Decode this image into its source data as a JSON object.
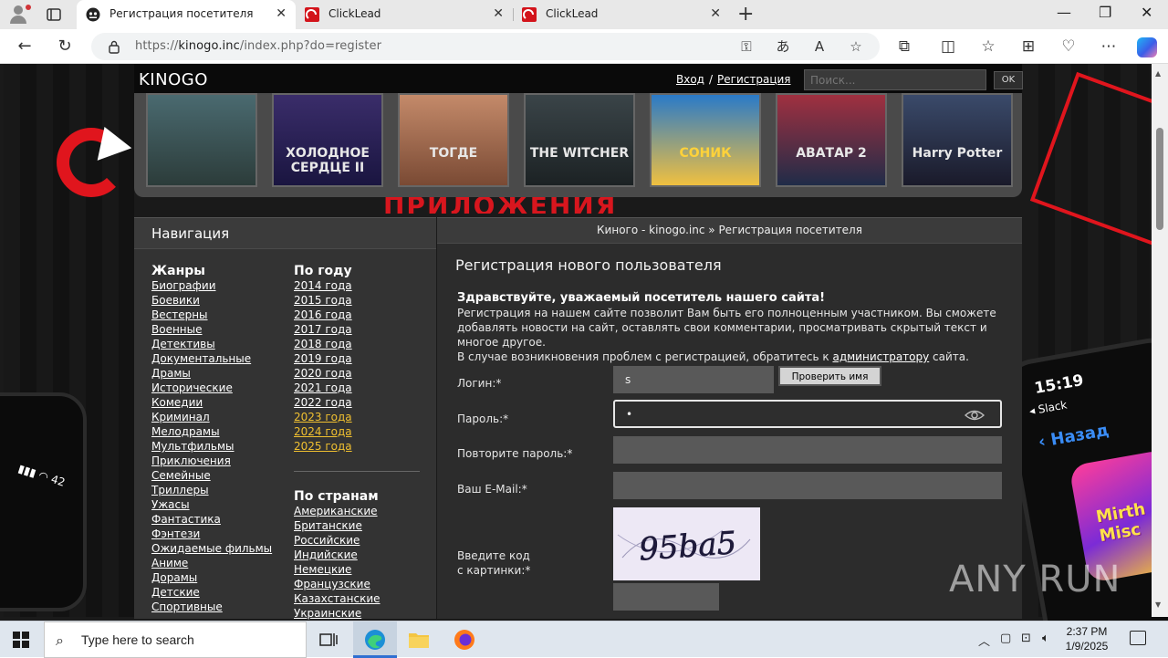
{
  "browser": {
    "tabs": [
      {
        "title": "Регистрация посетителя",
        "active": true
      },
      {
        "title": "ClickLead",
        "active": false
      },
      {
        "title": "ClickLead",
        "active": false
      }
    ],
    "url_prefix": "https://",
    "url_host": "kinogo.inc",
    "url_path": "/index.php?do=register"
  },
  "site": {
    "logo": "KINOGO",
    "login_link": "Вход",
    "link_separator": "/",
    "register_link": "Регистрация",
    "search_placeholder": "Поиск...",
    "search_button": "OK"
  },
  "slider": {
    "posters": [
      {
        "label": "",
        "colors": [
          "#4a6a70",
          "#2c3c3a"
        ]
      },
      {
        "label": "ХОЛОДНОЕ СЕРДЦЕ II",
        "colors": [
          "#3a2d6a",
          "#1a1540"
        ]
      },
      {
        "label": "ТОГДЕ",
        "colors": [
          "#c48a6a",
          "#7a4a34"
        ]
      },
      {
        "label": "THE WITCHER",
        "colors": [
          "#3a4448",
          "#1c2224"
        ]
      },
      {
        "label": "СОНИК",
        "colors": [
          "#2a7ac8",
          "#f0c040"
        ]
      },
      {
        "label": "АВАТАР 2",
        "colors": [
          "#a03040",
          "#202c48"
        ]
      },
      {
        "label": "Harry Potter",
        "colors": [
          "#3a4a6a",
          "#1a1a2a"
        ]
      }
    ]
  },
  "background": {
    "banner_text": "ПРИЛОЖЕНИЯ",
    "phone_left_status": "▮▮▮ ◠ 42",
    "phone_right_time": "15:19",
    "phone_right_slack": "◂ Slack",
    "phone_right_back": "‹ Назад",
    "phone_right_game": "Mirth Misc"
  },
  "sidebar": {
    "title": "Навигация",
    "genres_title": "Жанры",
    "genres": [
      "Биографии",
      "Боевики",
      "Вестерны",
      "Военные",
      "Детективы",
      "Документальные",
      "Драмы",
      "Исторические",
      "Комедии",
      "Криминал",
      "Мелодрамы",
      "Мультфильмы",
      "Приключения",
      "Семейные",
      "Триллеры",
      "Ужасы",
      "Фантастика",
      "Фэнтези",
      "Ожидаемые фильмы",
      "Аниме",
      "Дорамы",
      "Детские",
      "Спортивные"
    ],
    "years_title": "По году",
    "years": [
      {
        "label": "2014 года",
        "highlight": false
      },
      {
        "label": "2015 года",
        "highlight": false
      },
      {
        "label": "2016 года",
        "highlight": false
      },
      {
        "label": "2017 года",
        "highlight": false
      },
      {
        "label": "2018 года",
        "highlight": false
      },
      {
        "label": "2019 года",
        "highlight": false
      },
      {
        "label": "2020 года",
        "highlight": false
      },
      {
        "label": "2021 года",
        "highlight": false
      },
      {
        "label": "2022 года",
        "highlight": false
      },
      {
        "label": "2023 года",
        "highlight": true
      },
      {
        "label": "2024 года",
        "highlight": true
      },
      {
        "label": "2025 года",
        "highlight": true
      }
    ],
    "countries_title": "По странам",
    "countries": [
      "Американские",
      "Британские",
      "Российские",
      "Индийские",
      "Немецкие",
      "Французские",
      "Казахстанские",
      "Украинские"
    ]
  },
  "main": {
    "breadcrumb": "Киного - kinogo.inc » Регистрация посетителя",
    "heading": "Регистрация нового пользователя",
    "greeting": "Здравствуйте, уважаемый посетитель нашего сайта!",
    "intro_text": "Регистрация на нашем сайте позволит Вам быть его полноценным участником. Вы сможете добавлять новости на сайт, оставлять свои комментарии, просматривать скрытый текст и многое другое.",
    "problem_text_before": "В случае возникновения проблем с регистрацией, обратитесь к ",
    "admin_link": "администратору",
    "problem_text_after": " сайта.",
    "form": {
      "login_label": "Логин:*",
      "login_value": "s",
      "check_name_button": "Проверить имя",
      "password_label": "Пароль:*",
      "password_value": "•",
      "repeat_password_label": "Повторите пароль:*",
      "email_label": "Ваш E-Mail:*",
      "captcha_label_line1": "Введите код",
      "captcha_label_line2": "с картинки:*",
      "captcha_text": "95ba5"
    }
  },
  "watermark": "ANY RUN",
  "taskbar": {
    "search_placeholder": "Type here to search",
    "time": "2:37 PM",
    "date": "1/9/2025"
  }
}
